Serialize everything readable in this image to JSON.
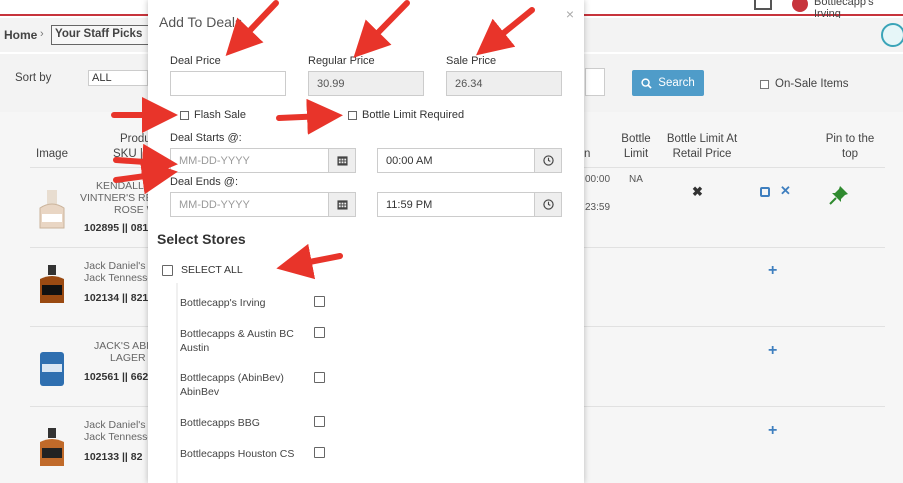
{
  "header": {
    "user_name": "Bottlecapp's Irving",
    "breadcrumb_home": "Home",
    "breadcrumb_sep": "›",
    "breadcrumb_current": "Your Staff Picks"
  },
  "filters": {
    "sort_label": "Sort by",
    "sort_value": "ALL",
    "search_label": "Search",
    "on_sale_label": "On-Sale Items"
  },
  "table": {
    "headers": {
      "image": "Image",
      "product_line1": "Produ",
      "product_line2": "SKU |",
      "col_n": "n",
      "bottle_limit_line1": "Bottle",
      "bottle_limit_line2": "Limit",
      "bottle_limit_retail_line1": "Bottle Limit At",
      "bottle_limit_retail_line2": "Retail Price",
      "pin_line1": "Pin to the",
      "pin_line2": "top"
    },
    "rows": [
      {
        "name_line1": "KENDALL-JA",
        "name_line2": "VINTNER'S RES",
        "name_line3": "ROSE W",
        "sku": "102895 || 081",
        "time1": "00:00",
        "time2": "23:59",
        "bottle_limit": "NA"
      },
      {
        "name_line1": "Jack Daniel's C",
        "name_line2": "Jack Tennesse",
        "sku": "102134 || 821"
      },
      {
        "name_line1": "JACK'S ABBY",
        "name_line2": "LAGER C",
        "sku": "102561 || 662"
      },
      {
        "name_line1": "Jack Daniel's C",
        "name_line2": "Jack Tennesse",
        "sku": "102133 || 82"
      }
    ]
  },
  "modal": {
    "title": "Add To Deals",
    "close": "×",
    "deal_price_label": "Deal Price",
    "deal_price_value": "",
    "regular_price_label": "Regular Price",
    "regular_price_value": "30.99",
    "sale_price_label": "Sale Price",
    "sale_price_value": "26.34",
    "flash_sale_label": "Flash Sale",
    "bottle_limit_label": "Bottle Limit Required",
    "deal_starts_label": "Deal Starts @:",
    "deal_starts_date_placeholder": "MM-DD-YYYY",
    "deal_starts_time": "00:00 AM",
    "deal_ends_label": "Deal Ends @:",
    "deal_ends_date_placeholder": "MM-DD-YYYY",
    "deal_ends_time": "11:59 PM",
    "select_stores_title": "Select Stores",
    "select_all_label": "SELECT ALL",
    "stores": [
      {
        "line1": "Bottlecapp's Irving",
        "line2": ""
      },
      {
        "line1": "Bottlecapps & Austin BC",
        "line2": "Austin"
      },
      {
        "line1": "Bottlecapps (AbinBev)",
        "line2": "AbinBev"
      },
      {
        "line1": "Bottlecapps BBG",
        "line2": ""
      },
      {
        "line1": "Bottlecapps Houston CS",
        "line2": ""
      }
    ]
  },
  "colors": {
    "accent_red": "#c7343c",
    "search_blue": "#4f9cc9",
    "icon_blue": "#3f7fbf",
    "pin_green": "#2f8a2f",
    "arrow_red": "#e8342a"
  }
}
